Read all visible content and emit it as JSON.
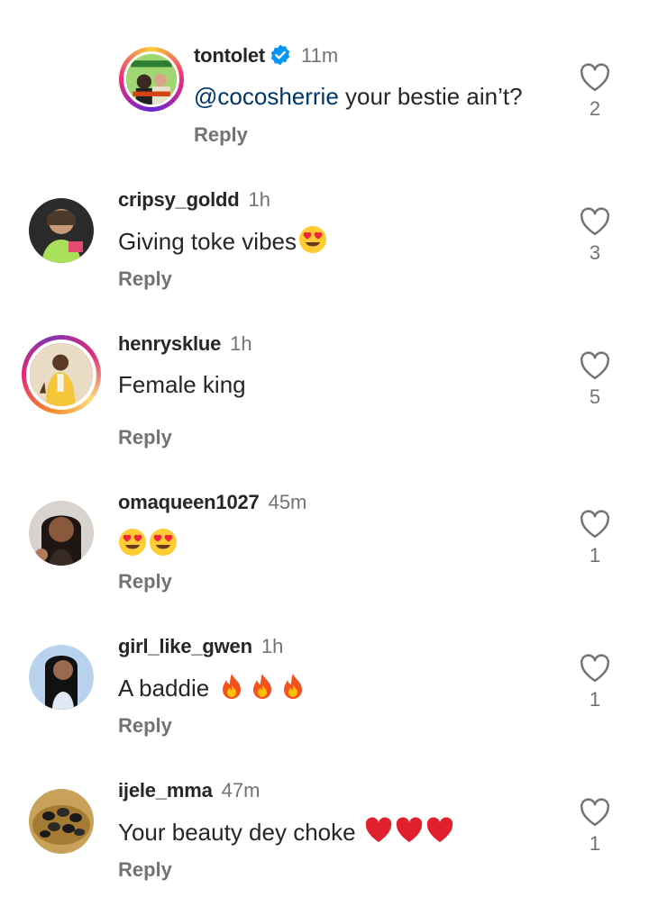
{
  "reply_label": "Reply",
  "colors": {
    "text": "#262626",
    "secondary": "#737373",
    "mention": "#00376b",
    "verified": "#0095f6"
  },
  "comments": [
    {
      "username": "tontolet",
      "verified": true,
      "time": "11m",
      "mention": "@cocosherrie",
      "text": " your bestie ain’t?",
      "likes": "2",
      "avatar": "poster-avatar"
    },
    {
      "username": "cripsy_goldd",
      "time": "1h",
      "text": "Giving toke vibes",
      "emojis": [
        "heart-eyes-emoji"
      ],
      "likes": "3",
      "avatar": "woman-avatar"
    },
    {
      "username": "henrysklue",
      "time": "1h",
      "text": "Female king",
      "likes": "5",
      "avatar": "man-yellow-suit-avatar"
    },
    {
      "username": "omaqueen1027",
      "time": "45m",
      "text": "",
      "emojis": [
        "heart-eyes-emoji",
        "heart-eyes-emoji"
      ],
      "likes": "1",
      "avatar": "woman-avatar"
    },
    {
      "username": "girl_like_gwen",
      "time": "1h",
      "text": "A baddie ",
      "emojis": [
        "fire-emoji",
        "fire-emoji",
        "fire-emoji"
      ],
      "likes": "1",
      "avatar": "woman-avatar"
    },
    {
      "username": "ijele_mma",
      "time": "47m",
      "text": "Your beauty dey choke ",
      "emojis": [
        "red-heart-emoji",
        "red-heart-emoji",
        "red-heart-emoji"
      ],
      "likes": "1",
      "avatar": "olives-avatar"
    }
  ]
}
